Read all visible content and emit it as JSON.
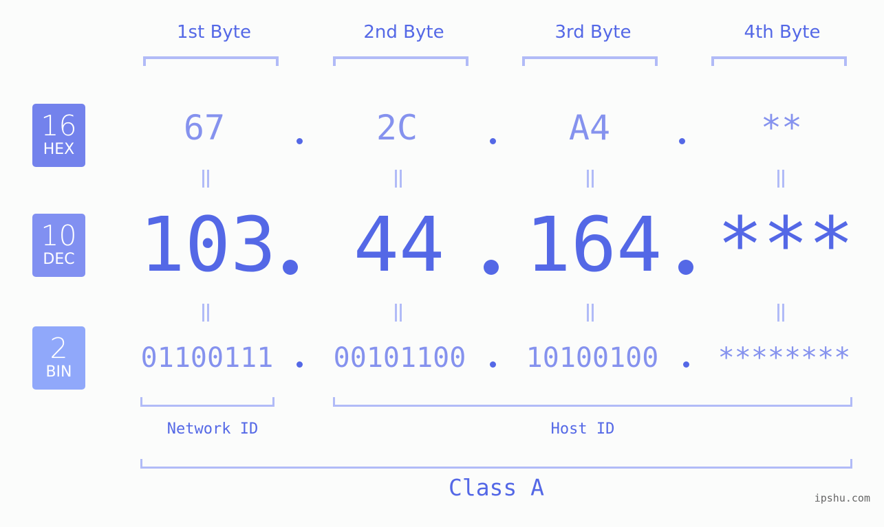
{
  "bytes": [
    {
      "label": "1st Byte",
      "hex": "67",
      "dec": "103",
      "bin": "01100111"
    },
    {
      "label": "2nd Byte",
      "hex": "2C",
      "dec": "44",
      "bin": "00101100"
    },
    {
      "label": "3rd Byte",
      "hex": "A4",
      "dec": "164",
      "bin": "10100100"
    },
    {
      "label": "4th Byte",
      "hex": "**",
      "dec": "***",
      "bin": "********"
    }
  ],
  "bases": [
    {
      "num": "16",
      "name": "HEX",
      "color": "#7382ec"
    },
    {
      "num": "10",
      "name": "DEC",
      "color": "#8190f1"
    },
    {
      "num": "2",
      "name": "BIN",
      "color": "#90a8fa"
    }
  ],
  "separator": ".",
  "ids": {
    "network": "Network ID",
    "host": "Host ID"
  },
  "ip_class": "Class A",
  "watermark": "ipshu.com",
  "colors": {
    "primary": "#5468e6",
    "light": "#8592ee",
    "bracket": "#b1bbf7",
    "background": "#fbfcfb"
  }
}
